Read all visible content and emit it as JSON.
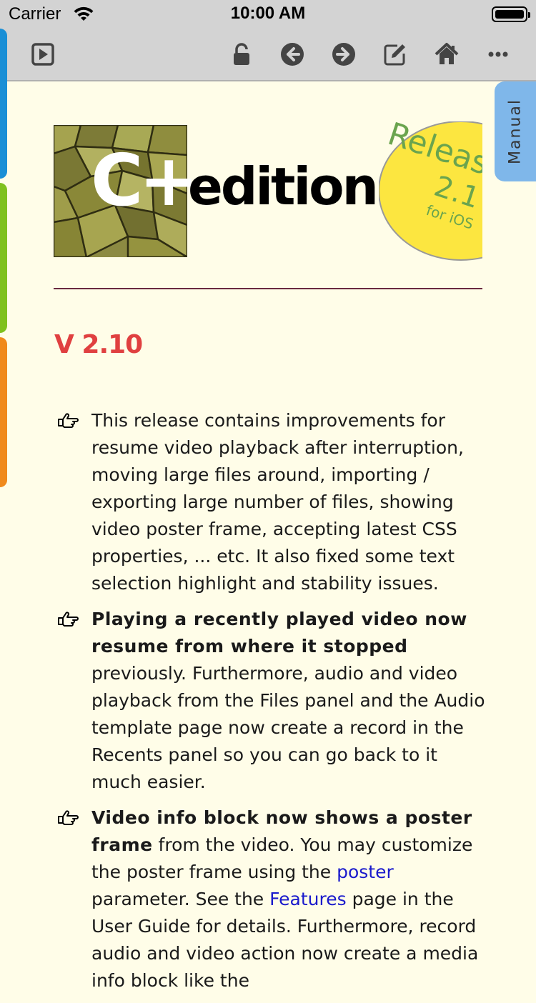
{
  "status_bar": {
    "carrier": "Carrier",
    "time": "10:00 AM"
  },
  "toolbar": {
    "icons": [
      "video-play-icon",
      "unlock-icon",
      "back-arrow-icon",
      "forward-arrow-icon",
      "edit-icon",
      "home-icon",
      "more-icon"
    ]
  },
  "side_tabs": {
    "colors": [
      "#1a8fd6",
      "#7fc11e",
      "#f08a1c"
    ]
  },
  "manual_tab": {
    "label": "Manual"
  },
  "banner": {
    "logo_main": "C+",
    "logo_word": "edition",
    "badge_line1": "Releas",
    "badge_line2": "2.1",
    "badge_line3": "for iOS"
  },
  "version": "V 2.10",
  "items": [
    {
      "text": "This release contains improvements for resume video playback after interruption, moving large files around, importing / exporting large number of files, showing video poster frame, accepting latest CSS properties, ... etc. It also fixed some text selection highlight and stability issues."
    },
    {
      "bold": "Playing a recently played video now resume from where it stopped",
      "text": " previously. Furthermore, audio and video playback from the Files panel and the Audio template page now create a record in the Recents panel so you can go back to it much easier."
    },
    {
      "bold": "Video info block now shows a poster frame",
      "text_a": " from the video. You may customize the poster frame using the ",
      "link1": "poster",
      "text_b": " parameter. See the ",
      "link2": "Features",
      "text_c": " page in the User Guide for details. Furthermore, record audio and video action now create a media info block like the"
    }
  ],
  "colors": {
    "accent_red": "#e04040",
    "link": "#1a1acc",
    "background": "#fffde8"
  }
}
